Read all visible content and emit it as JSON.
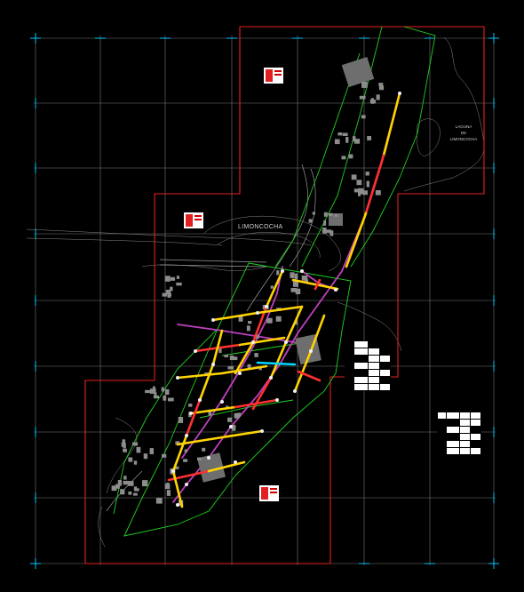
{
  "drawing": {
    "town_label": "LIMONCOCHA",
    "lagoon_label": [
      "LAGUNA",
      "DE",
      "LIMONCOCHA"
    ]
  },
  "legend_tables": [
    {
      "name": "legend-table-center",
      "rows": 7,
      "cols": 4
    },
    {
      "name": "legend-table-right",
      "rows": 7,
      "cols": 4
    }
  ],
  "colors": {
    "background": "#000000",
    "grid": "#7a7a7a",
    "sheet_frame": "#e0201e",
    "grid_marker": "#00c8ff",
    "zone_boundary": "#1fd21f",
    "trunk_line": "#c040c0",
    "pipe_segment": "#ffd400",
    "pipe_hot": "#ff3030",
    "pipe_cold": "#00d8ff",
    "road": "#9a9a9a",
    "building": "#8c8c8c"
  }
}
